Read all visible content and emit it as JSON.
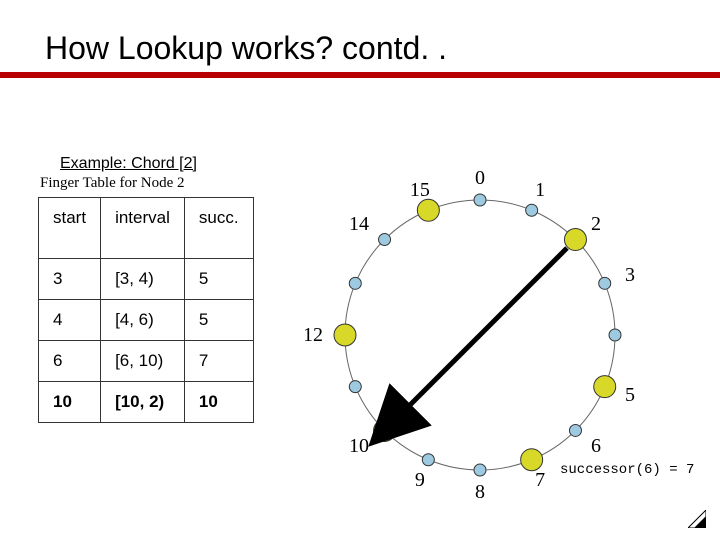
{
  "title": "How Lookup works? contd. .",
  "subtitle1": "Example: Chord [2]",
  "subtitle2": "Finger Table for Node 2",
  "table": {
    "headers": [
      "start",
      "interval",
      "succ."
    ],
    "rows": [
      {
        "start": "3",
        "interval": "[3, 4)",
        "succ": "5"
      },
      {
        "start": "4",
        "interval": "[4, 6)",
        "succ": "5"
      },
      {
        "start": "6",
        "interval": "[6, 10)",
        "succ": "7"
      },
      {
        "start": "10",
        "interval": "[10, 2)",
        "succ": "10"
      }
    ]
  },
  "ring": {
    "total_nodes": 16,
    "labeled": {
      "0": "0",
      "1": "1",
      "2": "2",
      "3": "3",
      "5": "5",
      "6": "6",
      "7": "7",
      "8": "8",
      "9": "9",
      "10": "10",
      "12": "12",
      "14": "14",
      "15": "15"
    },
    "filled_nodes": [
      2,
      5,
      7,
      10,
      12,
      15
    ],
    "arrow": {
      "from": 2,
      "to": 10
    }
  },
  "successor_label": "successor(6) = 7"
}
